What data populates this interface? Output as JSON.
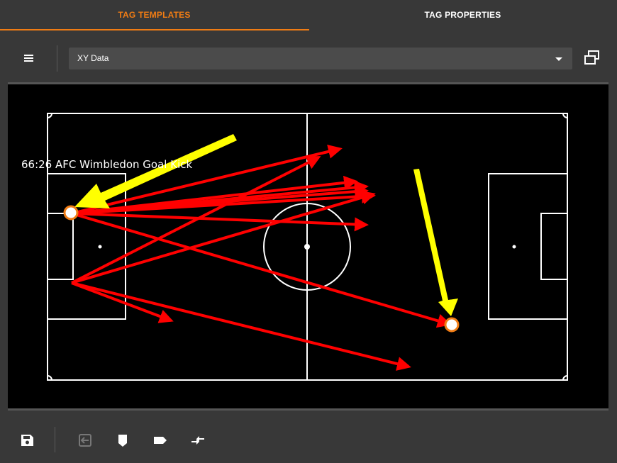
{
  "tabs": [
    {
      "label": "TAG TEMPLATES",
      "active": true
    },
    {
      "label": "TAG PROPERTIES",
      "active": false
    }
  ],
  "toolbar": {
    "menu_icon": "hamburger-menu-icon",
    "select": {
      "value": "XY Data"
    },
    "popout_icon": "restore-window-icon"
  },
  "pitch": {
    "event_label": "66:26 AFC Wimbledon Goal Kick",
    "colors": {
      "arrows": "#ff0000",
      "highlight": "#ffff00",
      "marker": "#f07c14",
      "lines": "#ffffff"
    },
    "markers": 2,
    "highlight_arrows": 2,
    "pass_arrows": 11
  },
  "bottom_toolbar": {
    "icons": [
      "save-icon",
      "exit-icon",
      "marker-tag-icon",
      "label-tag-icon",
      "compare-arrows-icon"
    ]
  },
  "colors": {
    "accent": "#f07c14",
    "background": "#383838",
    "field": "#4b4b4b"
  }
}
